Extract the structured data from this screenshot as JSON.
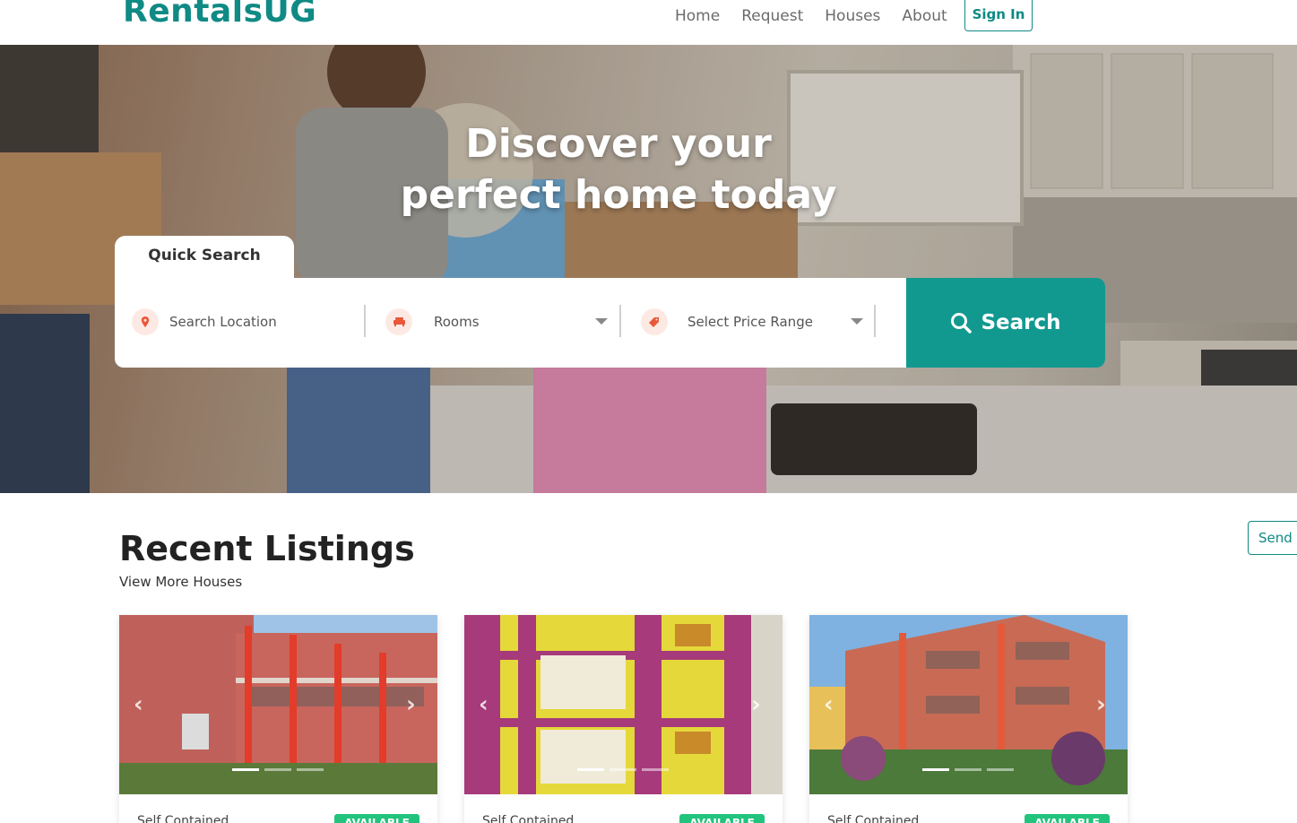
{
  "nav": {
    "brand": "RentalsUG",
    "links": [
      "Home",
      "Request",
      "Houses",
      "About"
    ],
    "signin": "Sign In"
  },
  "hero": {
    "title_line1": "Discover your",
    "title_line2": "perfect home today",
    "quick_search_tab": "Quick Search",
    "location_placeholder": "Search Location",
    "rooms_label": "Rooms",
    "price_label": "Select Price Range",
    "search_button": "Search"
  },
  "listings": {
    "title": "Recent Listings",
    "view_more": "View More Houses",
    "send_button": "Send u",
    "cards": [
      {
        "type": "Self Contained",
        "status": "AVAILABLE"
      },
      {
        "type": "Self Contained",
        "status": "AVAILABLE"
      },
      {
        "type": "Self Contained",
        "status": "AVAILABLE"
      }
    ]
  },
  "colors": {
    "brand": "#0f8a85",
    "search_button": "#119990",
    "badge": "#22c47d"
  }
}
